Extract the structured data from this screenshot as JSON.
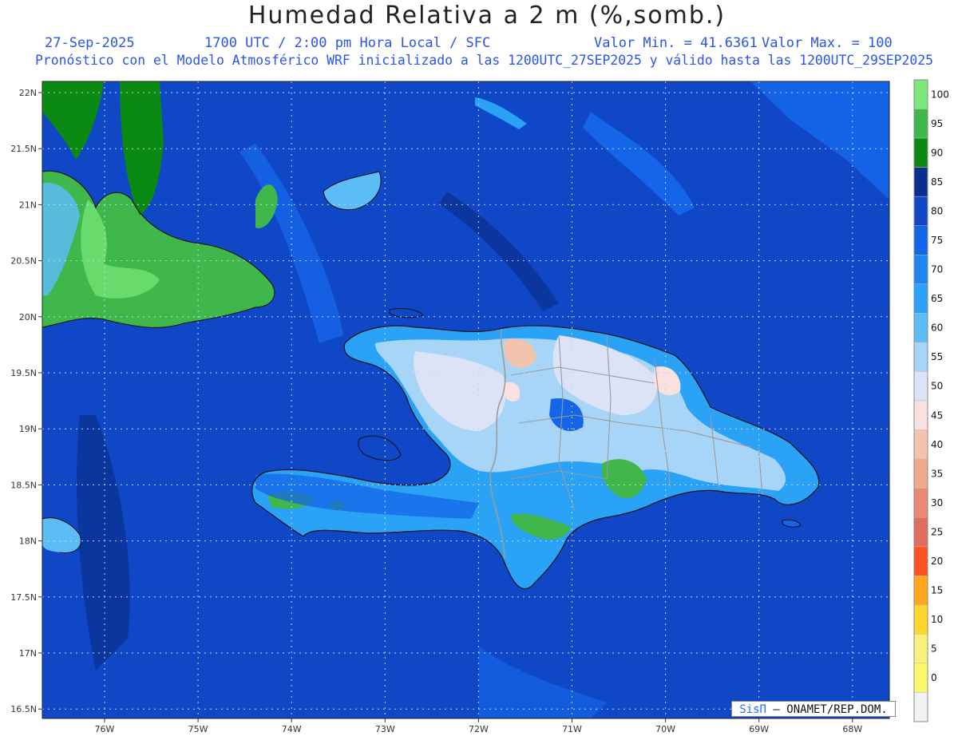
{
  "title": "Humedad Relativa a 2 m (%,somb.)",
  "line1": {
    "date": "27-Sep-2025",
    "time": "1700 UTC / 2:00 pm Hora Local / SFC",
    "min": "Valor Min. = 41.6361",
    "max": "Valor Max. = 100"
  },
  "line2": "Pronóstico con el Modelo Atmosférico WRF inicializado a las 1200UTC_27SEP2025 y válido hasta las  1200UTC_29SEP2025",
  "lat_labels": [
    "22N",
    "21.5N",
    "21N",
    "20.5N",
    "20N",
    "19.5N",
    "19N",
    "18.5N",
    "18N",
    "17.5N",
    "17N",
    "16.5N"
  ],
  "lon_labels": [
    "76W",
    "75W",
    "74W",
    "73W",
    "72W",
    "71W",
    "70W",
    "69W",
    "68W"
  ],
  "legend": {
    "labels": [
      "100",
      "95",
      "90",
      "85",
      "80",
      "75",
      "70",
      "65",
      "60",
      "55",
      "50",
      "45",
      "40",
      "35",
      "30",
      "25",
      "20",
      "15",
      "10",
      "5",
      "0"
    ],
    "colors": [
      "#7ce97a",
      "#3fb74a",
      "#0a8a12",
      "#082f8c",
      "#0f47c7",
      "#1565e8",
      "#1d86ef",
      "#2aa3f6",
      "#5cbcf6",
      "#a7d5f7",
      "#dde3f6",
      "#f8e1de",
      "#f2c3ad",
      "#eeab8c",
      "#e98976",
      "#e06e5e",
      "#fd5522",
      "#ffa81e",
      "#ffd42d",
      "#fbf07a",
      "#fdf86a",
      "#f2f2f2"
    ]
  },
  "footer": {
    "brand": "SisΠ",
    "agency": "– ONAMET/REP.DOM."
  }
}
